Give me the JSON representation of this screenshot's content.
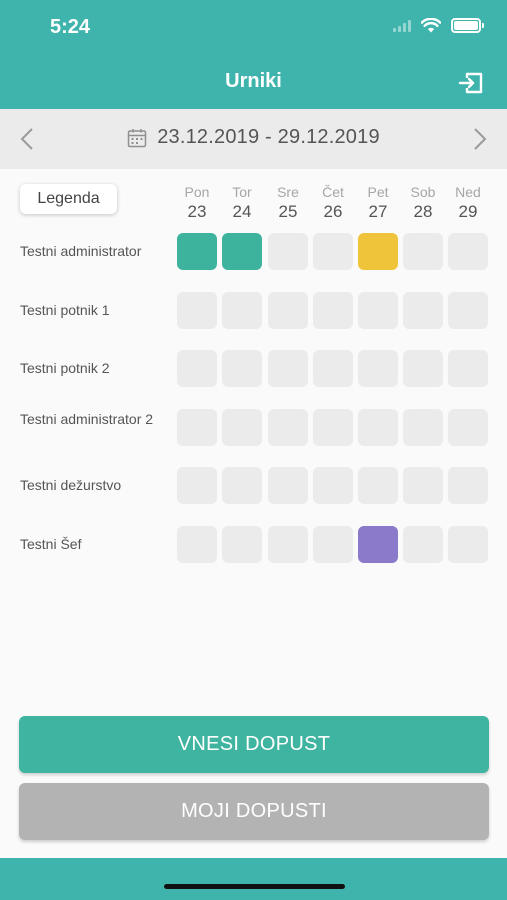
{
  "status_bar": {
    "time": "5:24"
  },
  "header": {
    "title": "Urniki"
  },
  "week": {
    "range": "23.12.2019 - 29.12.2019"
  },
  "legend": {
    "label": "Legenda"
  },
  "days": [
    {
      "name": "Pon",
      "num": "23"
    },
    {
      "name": "Tor",
      "num": "24"
    },
    {
      "name": "Sre",
      "num": "25"
    },
    {
      "name": "Čet",
      "num": "26"
    },
    {
      "name": "Pet",
      "num": "27"
    },
    {
      "name": "Sob",
      "num": "28"
    },
    {
      "name": "Ned",
      "num": "29"
    }
  ],
  "colors": {
    "empty": "#ebebeb",
    "green": "#3db39e",
    "yellow": "#f0c43a",
    "purple": "#8a7ac9"
  },
  "people": [
    {
      "name": "Testni administrator",
      "cells": [
        "green",
        "green",
        "empty",
        "empty",
        "yellow",
        "empty",
        "empty"
      ]
    },
    {
      "name": "Testni potnik 1",
      "cells": [
        "empty",
        "empty",
        "empty",
        "empty",
        "empty",
        "empty",
        "empty"
      ]
    },
    {
      "name": "Testni potnik 2",
      "cells": [
        "empty",
        "empty",
        "empty",
        "empty",
        "empty",
        "empty",
        "empty"
      ]
    },
    {
      "name": "Testni administrator 2",
      "cells": [
        "empty",
        "empty",
        "empty",
        "empty",
        "empty",
        "empty",
        "empty"
      ]
    },
    {
      "name": "Testni dežurstvo",
      "cells": [
        "empty",
        "empty",
        "empty",
        "empty",
        "empty",
        "empty",
        "empty"
      ]
    },
    {
      "name": "Testni Šef",
      "cells": [
        "empty",
        "empty",
        "empty",
        "empty",
        "purple",
        "empty",
        "empty"
      ]
    }
  ],
  "buttons": {
    "primary": "VNESI DOPUST",
    "secondary": "MOJI DOPUSTI"
  }
}
